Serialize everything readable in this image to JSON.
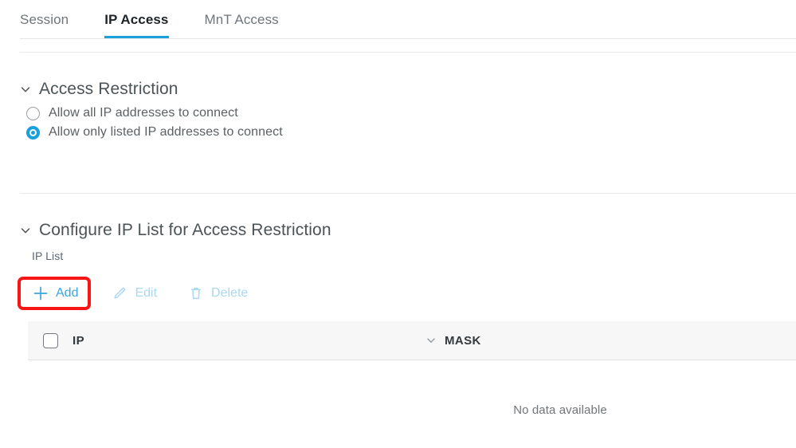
{
  "tabs": [
    {
      "label": "Session",
      "active": false
    },
    {
      "label": "IP Access",
      "active": true
    },
    {
      "label": "MnT Access",
      "active": false
    }
  ],
  "access_restriction": {
    "title": "Access Restriction",
    "chevron_icon": "chevron-down-icon",
    "options": [
      {
        "label": "Allow all IP addresses to connect",
        "selected": false
      },
      {
        "label": "Allow only listed IP addresses to connect",
        "selected": true
      }
    ]
  },
  "configure_ip_list": {
    "title": "Configure IP List for Access Restriction",
    "chevron_icon": "chevron-down-icon",
    "list_label": "IP List",
    "toolbar": {
      "add_label": "Add",
      "add_icon": "plus-icon",
      "edit_label": "Edit",
      "edit_icon": "pencil-icon",
      "delete_label": "Delete",
      "delete_icon": "trash-icon"
    },
    "table": {
      "select_all_icon": "checkbox-icon",
      "columns": [
        {
          "label": "IP",
          "sort_icon": "chevron-down-icon"
        },
        {
          "label": "MASK"
        }
      ],
      "rows": [],
      "empty_message": "No data available"
    }
  },
  "annotation": {
    "target": "add-button",
    "color": "#f61616"
  },
  "colors": {
    "accent": "#1aa0db",
    "link": "#3ba6e0",
    "link_disabled": "#a9d8f2",
    "annotation": "#f61616",
    "table_header_bg": "#f7f7f8"
  }
}
